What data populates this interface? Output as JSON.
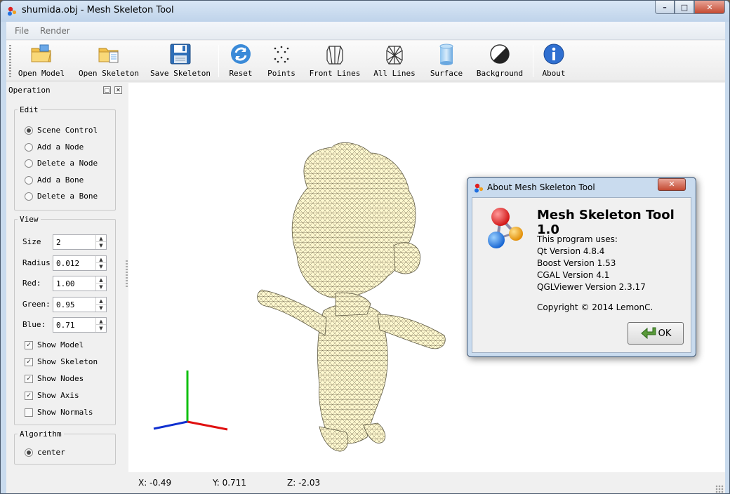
{
  "window": {
    "title": "shumida.obj - Mesh Skeleton Tool",
    "controls": [
      "–",
      "□",
      "✕"
    ]
  },
  "menubar": {
    "items": [
      "File",
      "Render"
    ]
  },
  "toolbar": {
    "buttons": [
      {
        "label": "Open Model",
        "icon": "open-folder-icon"
      },
      {
        "label": "Open Skeleton",
        "icon": "open-file-icon"
      },
      {
        "label": "Save Skeleton",
        "icon": "floppy-disk-icon"
      },
      {
        "label": "Reset",
        "icon": "refresh-icon"
      },
      {
        "label": "Points",
        "icon": "points-icon"
      },
      {
        "label": "Front Lines",
        "icon": "front-lines-icon"
      },
      {
        "label": "All Lines",
        "icon": "all-lines-icon"
      },
      {
        "label": "Surface",
        "icon": "surface-cylinder-icon"
      },
      {
        "label": "Background",
        "icon": "background-contrast-icon"
      },
      {
        "label": "About",
        "icon": "info-icon"
      }
    ]
  },
  "dock": {
    "title": "Operation",
    "edit": {
      "legend": "Edit",
      "options": [
        "Scene Control",
        "Add a Node",
        "Delete a Node",
        "Add a Bone",
        "Delete a Bone"
      ],
      "selected_index": 0
    },
    "view": {
      "legend": "View",
      "fields": [
        {
          "label": "Size",
          "value": "2"
        },
        {
          "label": "Radius",
          "value": "0.012"
        },
        {
          "label": "Red:",
          "value": "1.00"
        },
        {
          "label": "Green:",
          "value": "0.95"
        },
        {
          "label": "Blue:",
          "value": "0.71"
        }
      ],
      "checks": [
        {
          "label": "Show Model",
          "checked": true
        },
        {
          "label": "Show Skeleton",
          "checked": true
        },
        {
          "label": "Show Nodes",
          "checked": true
        },
        {
          "label": "Show Axis",
          "checked": true
        },
        {
          "label": "Show Normals",
          "checked": false
        }
      ]
    },
    "algorithm": {
      "legend": "Algorithm",
      "options": [
        "center"
      ],
      "selected_index": 0
    }
  },
  "viewport": {
    "model_color": "#fff5c4",
    "axis_colors": {
      "x": "#e01010",
      "y": "#10c010",
      "z": "#1030d0"
    }
  },
  "statusbar": {
    "x": "X: -0.49",
    "y": "Y: 0.711",
    "z": "Z: -2.03"
  },
  "about": {
    "title": "About Mesh Skeleton Tool",
    "heading": "Mesh Skeleton Tool 1.0",
    "lines": [
      "This program uses:",
      "Qt Version 4.8.4",
      "Boost Version 1.53",
      "CGAL Version 4.1",
      "QGLViewer Version 2.3.17"
    ],
    "copyright": "Copyright © 2014 LemonC.",
    "ok_label": "OK",
    "close": "✕"
  }
}
